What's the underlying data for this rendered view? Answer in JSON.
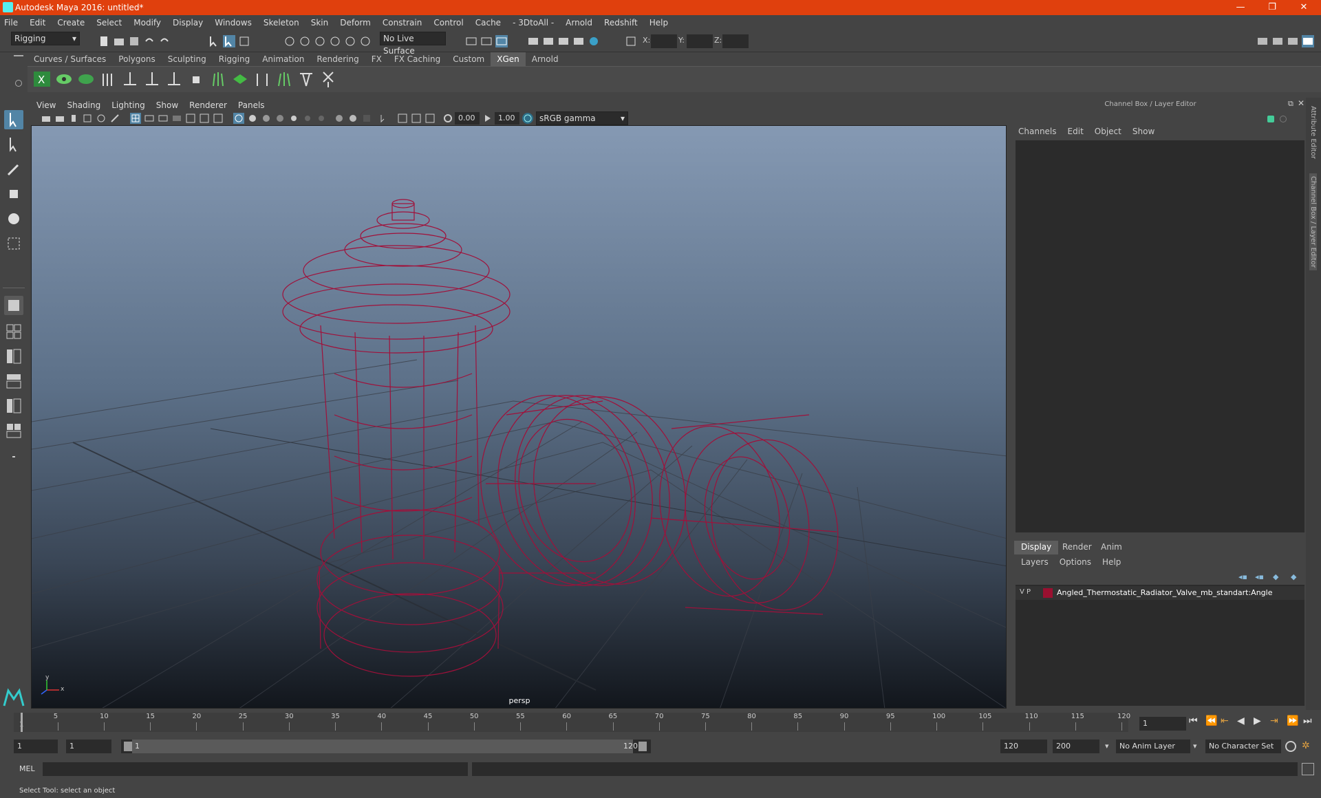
{
  "window": {
    "title": "Autodesk Maya 2016: untitled*",
    "min": "—",
    "max": "❐",
    "close": "✕"
  },
  "menu": [
    "File",
    "Edit",
    "Create",
    "Select",
    "Modify",
    "Display",
    "Windows",
    "Skeleton",
    "Skin",
    "Deform",
    "Constrain",
    "Control",
    "Cache",
    "- 3DtoAll -",
    "Arnold",
    "Redshift",
    "Help"
  ],
  "status": {
    "mode": "Rigging",
    "live_surface": "No Live Surface",
    "x": "X:",
    "y": "Y:",
    "z": "Z:"
  },
  "shelf_tabs": [
    "Curves / Surfaces",
    "Polygons",
    "Sculpting",
    "Rigging",
    "Animation",
    "Rendering",
    "FX",
    "FX Caching",
    "Custom",
    "XGen",
    "Arnold"
  ],
  "active_shelf": "XGen",
  "viewport": {
    "menu": [
      "View",
      "Shading",
      "Lighting",
      "Show",
      "Renderer",
      "Panels"
    ],
    "exposure": "0.00",
    "gamma": "1.00",
    "colorspace": "sRGB gamma",
    "camera": "persp",
    "axis_x": "x",
    "axis_y": "y"
  },
  "channel_box": {
    "title": "Channel Box / Layer Editor",
    "menu": [
      "Channels",
      "Edit",
      "Object",
      "Show"
    ]
  },
  "layer_editor": {
    "tabs": [
      "Display",
      "Render",
      "Anim"
    ],
    "menu": [
      "Layers",
      "Options",
      "Help"
    ],
    "layer_v": "V",
    "layer_p": "P",
    "layer_name": "Angled_Thermostatic_Radiator_Valve_mb_standart:Angle",
    "layer_color": "#9a1030"
  },
  "side_tabs": [
    "Attribute Editor",
    "Channel Box / Layer Editor"
  ],
  "timeline": {
    "ticks": [
      "5",
      "10",
      "15",
      "20",
      "25",
      "30",
      "35",
      "40",
      "45",
      "50",
      "55",
      "60",
      "65",
      "70",
      "75",
      "80",
      "85",
      "90",
      "95",
      "100",
      "105",
      "110",
      "115",
      "120"
    ],
    "start_tick": "1",
    "current_frame": "1"
  },
  "range": {
    "start": "1",
    "start2": "1",
    "slider_start": "1",
    "slider_end": "120",
    "end": "120",
    "end2": "200",
    "anim_layer": "No Anim Layer",
    "char_set": "No Character Set"
  },
  "mel_label": "MEL",
  "help_text": "Select Tool: select an object",
  "wire_color": "#a0103a"
}
